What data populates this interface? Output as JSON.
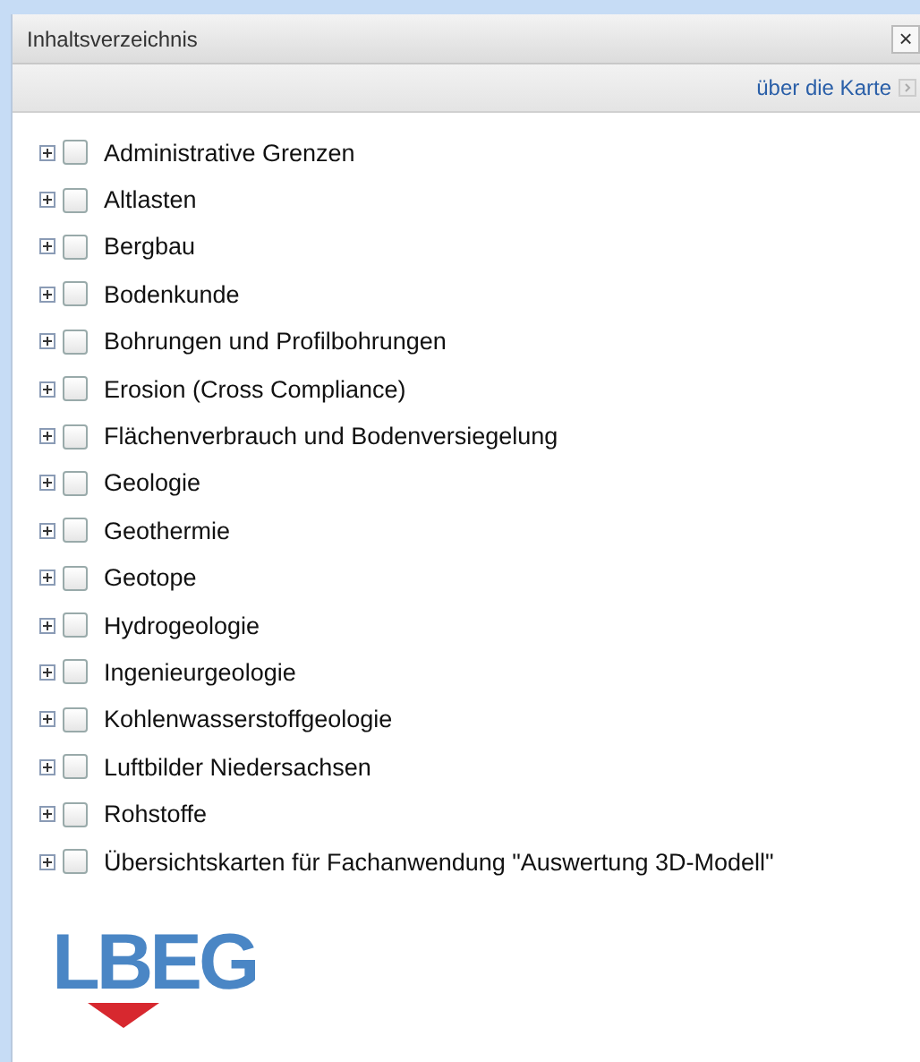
{
  "panel": {
    "title": "Inhaltsverzeichnis",
    "close_label": "×",
    "about_link": "über die Karte"
  },
  "layers": [
    {
      "label": "Administrative Grenzen",
      "checked": false,
      "expanded": false
    },
    {
      "label": "Altlasten",
      "checked": false,
      "expanded": false
    },
    {
      "label": "Bergbau",
      "checked": false,
      "expanded": false
    },
    {
      "label": "Bodenkunde",
      "checked": false,
      "expanded": false
    },
    {
      "label": "Bohrungen und Profilbohrungen",
      "checked": false,
      "expanded": false
    },
    {
      "label": "Erosion (Cross Compliance)",
      "checked": false,
      "expanded": false
    },
    {
      "label": "Flächenverbrauch und Bodenversiegelung",
      "checked": false,
      "expanded": false
    },
    {
      "label": "Geologie",
      "checked": false,
      "expanded": false
    },
    {
      "label": "Geothermie",
      "checked": false,
      "expanded": false
    },
    {
      "label": "Geotope",
      "checked": false,
      "expanded": false
    },
    {
      "label": "Hydrogeologie",
      "checked": false,
      "expanded": false
    },
    {
      "label": "Ingenieurgeologie",
      "checked": false,
      "expanded": false
    },
    {
      "label": "Kohlenwasserstoffgeologie",
      "checked": false,
      "expanded": false
    },
    {
      "label": "Luftbilder Niedersachsen",
      "checked": false,
      "expanded": false
    },
    {
      "label": "Rohstoffe",
      "checked": false,
      "expanded": false
    },
    {
      "label": "Übersichtskarten für Fachanwendung \"Auswertung 3D-Modell\"",
      "checked": false,
      "expanded": false
    }
  ],
  "logo": {
    "text": "LBEG"
  }
}
